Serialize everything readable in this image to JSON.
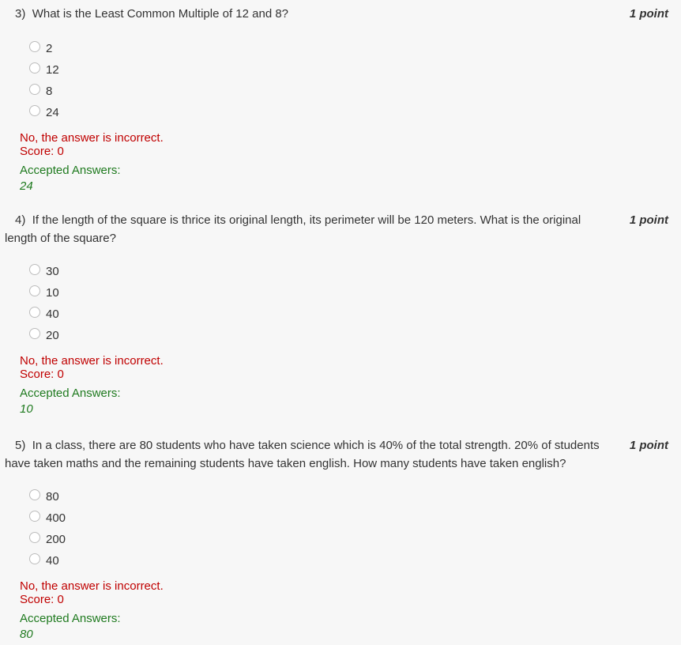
{
  "questions": [
    {
      "number": "3)",
      "text": "What is the Least Common Multiple of 12 and 8?",
      "points": "1 point",
      "options": [
        "2",
        "12",
        "8",
        "24"
      ],
      "feedback_incorrect": "No, the answer is incorrect.",
      "score": "Score: 0",
      "accepted_label": "Accepted Answers:",
      "accepted_value": "24"
    },
    {
      "number": "4)",
      "text": "If the length of the square is thrice its original length, its perimeter will be 120 meters. What is the original length of the square?",
      "points": "1 point",
      "options": [
        "30",
        "10",
        "40",
        "20"
      ],
      "feedback_incorrect": "No, the answer is incorrect.",
      "score": "Score: 0",
      "accepted_label": "Accepted Answers:",
      "accepted_value": "10"
    },
    {
      "number": "5)",
      "text": "In a class, there are 80 students who have taken science which is 40% of the total strength. 20% of students have taken maths and the remaining students have taken english. How many students have taken english?",
      "points": "1 point",
      "options": [
        "80",
        "400",
        "200",
        "40"
      ],
      "feedback_incorrect": "No, the answer is incorrect.",
      "score": "Score: 0",
      "accepted_label": "Accepted Answers:",
      "accepted_value": "80"
    }
  ]
}
